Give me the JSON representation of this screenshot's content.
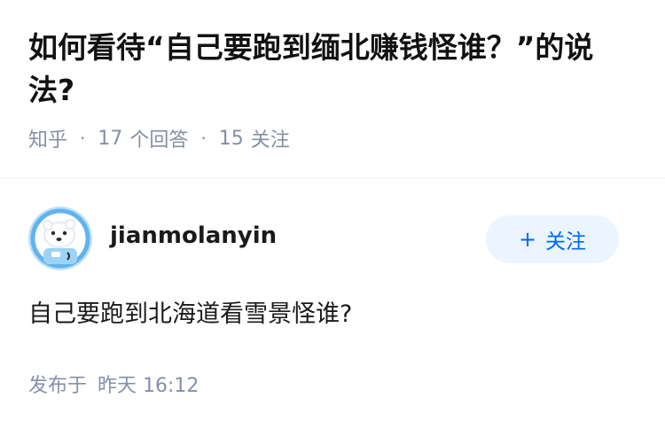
{
  "question": {
    "title": "如何看待“自己要跑到缅北赚钱怪谁？”的说法?",
    "source": "知乎",
    "separator": "·",
    "answers_count": "17",
    "answers_label": "个回答",
    "followers_count": "15",
    "followers_label": "关注"
  },
  "answer": {
    "author": {
      "name": "jianmolanyin",
      "avatar_icon": "polar-bear-astronaut-avatar"
    },
    "follow_button": {
      "icon": "plus-icon",
      "icon_glyph": "+",
      "label": "关注"
    },
    "content": "自己要跑到北海道看雪景怪谁?",
    "published_label": "发布于",
    "published_time": "昨天 16:12"
  },
  "colors": {
    "accent": "#0066ff",
    "button_bg": "#ebf5ff",
    "meta_text": "#8590a6",
    "title_text": "#121212"
  }
}
